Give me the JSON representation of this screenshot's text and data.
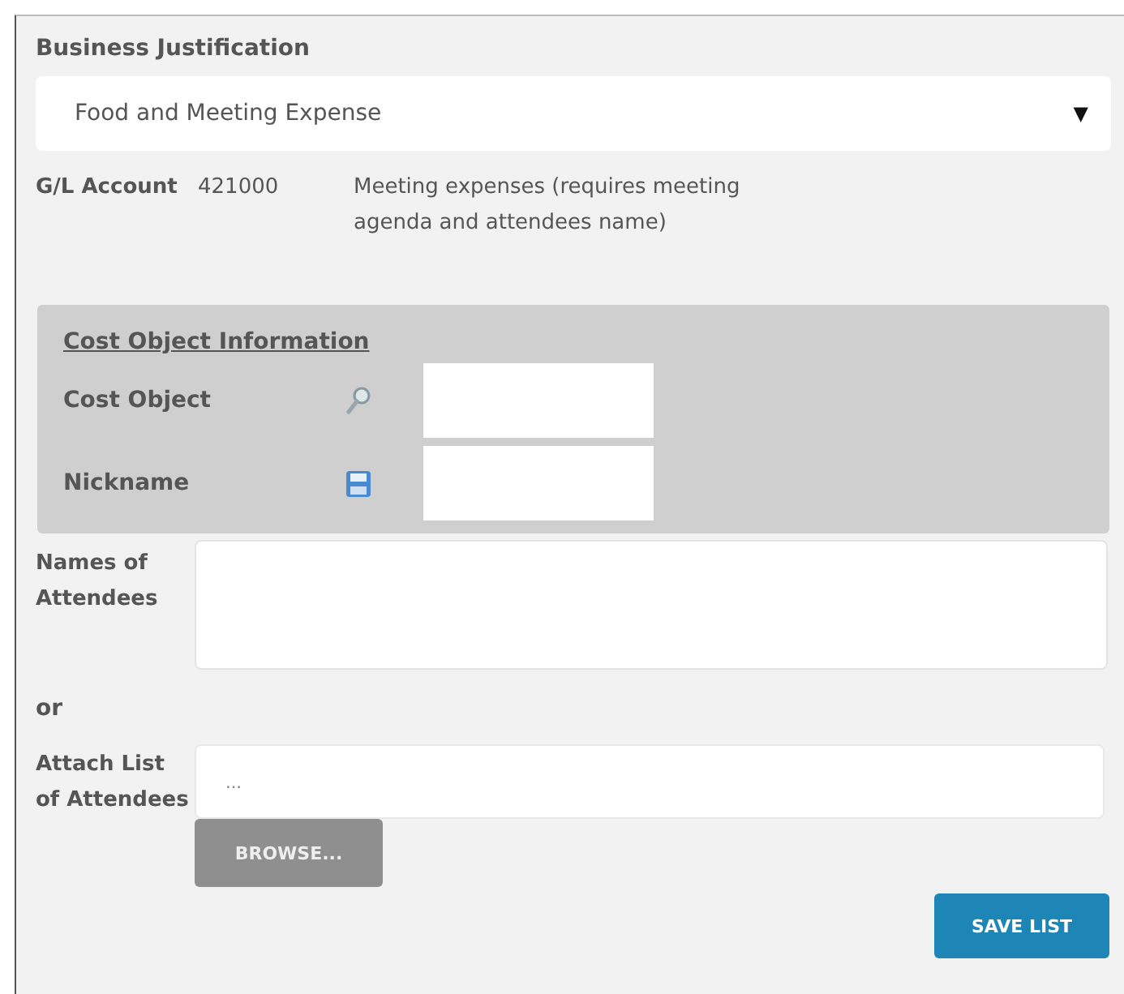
{
  "business_justification": {
    "label": "Business Justification",
    "select": {
      "value": "Food and Meeting Expense",
      "arrow": "▼"
    }
  },
  "gl_account": {
    "label": "G/L Account",
    "number": "421000",
    "description": "Meeting expenses (requires meeting agenda and attendees name)"
  },
  "cost_object_info": {
    "heading": "Cost Object Information",
    "rows": [
      {
        "kind": "search",
        "label": "Cost Object"
      },
      {
        "kind": "save",
        "label": "Nickname"
      }
    ]
  },
  "attendees": {
    "label": "Names of Attendees"
  },
  "or": "or",
  "attach": {
    "label": "Attach List of Attendees",
    "placeholder": "...",
    "browse": "BROWSE..."
  },
  "save_button": "SAVE LIST"
}
